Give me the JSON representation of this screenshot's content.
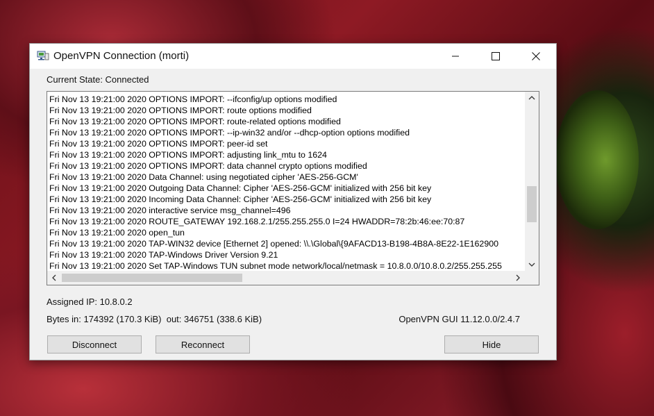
{
  "window": {
    "title": "OpenVPN Connection (morti)",
    "icon": "network-computer-icon"
  },
  "status": {
    "current_state": "Current State: Connected"
  },
  "log": {
    "lines": [
      "Fri Nov 13 19:21:00 2020 OPTIONS IMPORT: --ifconfig/up options modified",
      "Fri Nov 13 19:21:00 2020 OPTIONS IMPORT: route options modified",
      "Fri Nov 13 19:21:00 2020 OPTIONS IMPORT: route-related options modified",
      "Fri Nov 13 19:21:00 2020 OPTIONS IMPORT: --ip-win32 and/or --dhcp-option options modified",
      "Fri Nov 13 19:21:00 2020 OPTIONS IMPORT: peer-id set",
      "Fri Nov 13 19:21:00 2020 OPTIONS IMPORT: adjusting link_mtu to 1624",
      "Fri Nov 13 19:21:00 2020 OPTIONS IMPORT: data channel crypto options modified",
      "Fri Nov 13 19:21:00 2020 Data Channel: using negotiated cipher 'AES-256-GCM'",
      "Fri Nov 13 19:21:00 2020 Outgoing Data Channel: Cipher 'AES-256-GCM' initialized with 256 bit key",
      "Fri Nov 13 19:21:00 2020 Incoming Data Channel: Cipher 'AES-256-GCM' initialized with 256 bit key",
      "Fri Nov 13 19:21:00 2020 interactive service msg_channel=496",
      "Fri Nov 13 19:21:00 2020 ROUTE_GATEWAY 192.168.2.1/255.255.255.0 I=24 HWADDR=78:2b:46:ee:70:87",
      "Fri Nov 13 19:21:00 2020 open_tun",
      "Fri Nov 13 19:21:00 2020 TAP-WIN32 device [Ethernet 2] opened: \\\\.\\Global\\{9AFACD13-B198-4B8A-8E22-1E162900",
      "Fri Nov 13 19:21:00 2020 TAP-Windows Driver Version 9.21",
      "Fri Nov 13 19:21:00 2020 Set TAP-Windows TUN subnet mode network/local/netmask = 10.8.0.0/10.8.0.2/255.255.255"
    ]
  },
  "info": {
    "assigned_ip": "Assigned IP: 10.8.0.2",
    "bytes": "Bytes in: 174392 (170.3 KiB)  out: 346751 (338.6 KiB)",
    "version": "OpenVPN GUI 11.12.0.0/2.4.7"
  },
  "buttons": {
    "disconnect": "Disconnect",
    "reconnect": "Reconnect",
    "hide": "Hide"
  }
}
